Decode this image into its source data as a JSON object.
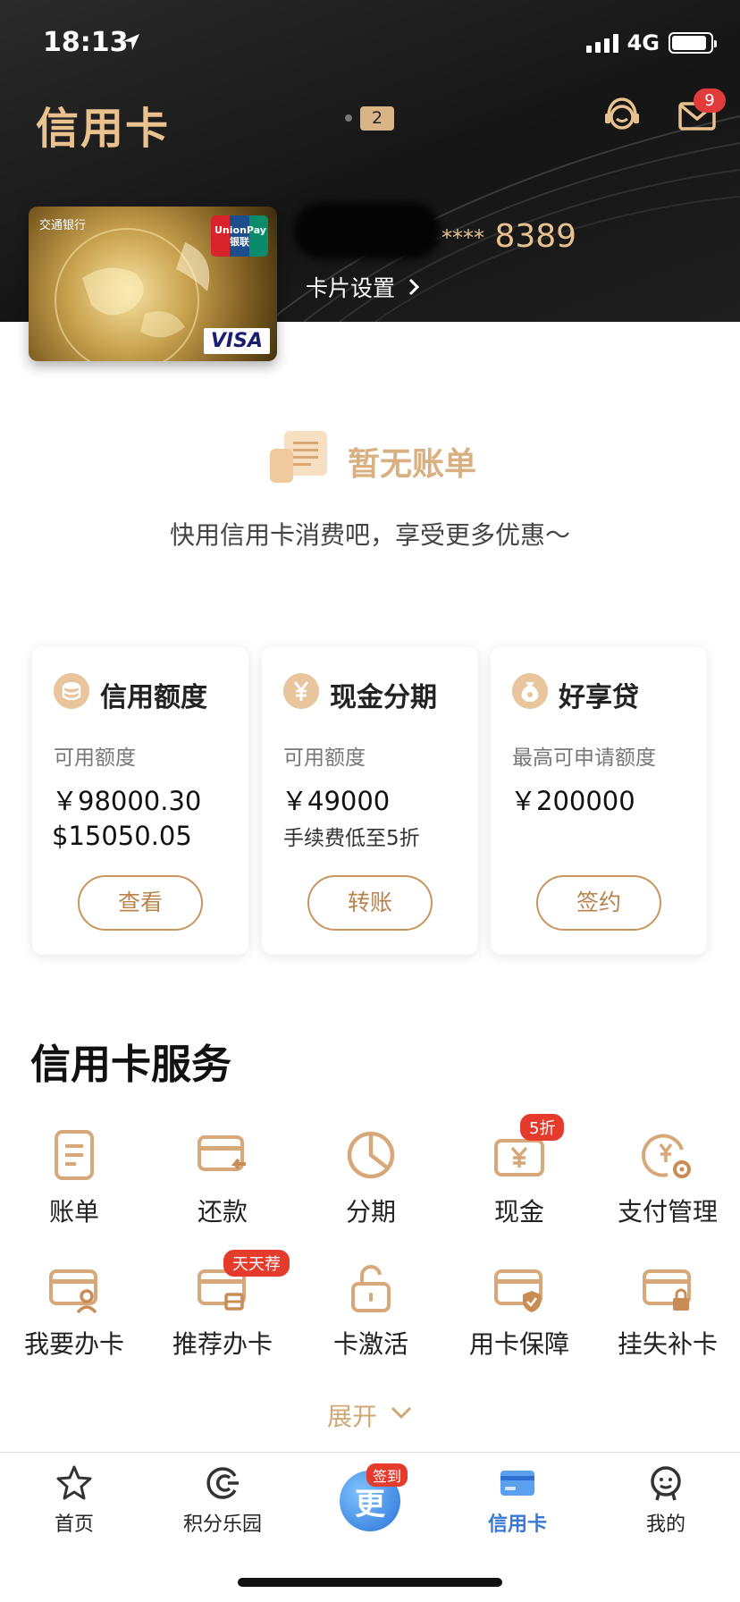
{
  "status_bar": {
    "time": "18:13",
    "network": "4G",
    "battery_level": 0.9
  },
  "header": {
    "title": "信用卡",
    "page_indicator": "2",
    "mail_badge": "9"
  },
  "card": {
    "bank_name": "交通银行",
    "card_brand": "VISA",
    "network_logo": "UnionPay 银联",
    "number_mask": "****",
    "number_last4": "8389",
    "settings_label": "卡片设置"
  },
  "bill": {
    "empty_title": "暂无账单",
    "empty_subtitle": "快用信用卡消费吧，享受更多优惠～"
  },
  "products": [
    {
      "title": "信用额度",
      "icon": "coins-icon",
      "label": "可用额度",
      "values": [
        "￥98000.30",
        "$15050.05"
      ],
      "note": "",
      "button": "查看"
    },
    {
      "title": "现金分期",
      "icon": "yuan-icon",
      "label": "可用额度",
      "values": [
        "￥49000"
      ],
      "note": "手续费低至5折",
      "button": "转账"
    },
    {
      "title": "好享贷",
      "icon": "money-bag-icon",
      "label": "最高可申请额度",
      "values": [
        "￥200000"
      ],
      "note": "",
      "button": "签约"
    }
  ],
  "services_section": {
    "title": "信用卡服务",
    "items": [
      {
        "label": "账单",
        "icon": "bill-icon",
        "badge": ""
      },
      {
        "label": "还款",
        "icon": "repay-icon",
        "badge": ""
      },
      {
        "label": "分期",
        "icon": "installment-icon",
        "badge": ""
      },
      {
        "label": "现金",
        "icon": "cash-icon",
        "badge": "5折"
      },
      {
        "label": "支付管理",
        "icon": "payment-settings-icon",
        "badge": ""
      },
      {
        "label": "我要办卡",
        "icon": "apply-card-icon",
        "badge": ""
      },
      {
        "label": "推荐办卡",
        "icon": "recommend-card-icon",
        "badge": "天天荐"
      },
      {
        "label": "卡激活",
        "icon": "activate-icon",
        "badge": ""
      },
      {
        "label": "用卡保障",
        "icon": "card-protection-icon",
        "badge": ""
      },
      {
        "label": "挂失补卡",
        "icon": "report-loss-icon",
        "badge": ""
      }
    ],
    "expand_label": "展开"
  },
  "bottom_nav": {
    "items": [
      {
        "label": "首页",
        "icon": "star-icon",
        "active": false
      },
      {
        "label": "积分乐园",
        "icon": "points-icon",
        "active": false
      },
      {
        "label": "信用卡",
        "icon": "credit-card-icon",
        "active": true
      },
      {
        "label": "我的",
        "icon": "profile-icon",
        "active": false
      }
    ],
    "center": {
      "glyph": "更",
      "badge": "签到"
    }
  },
  "colors": {
    "accent_gold": "#c8955e",
    "active_blue": "#3a78d6",
    "badge_red": "#e43b2c"
  }
}
